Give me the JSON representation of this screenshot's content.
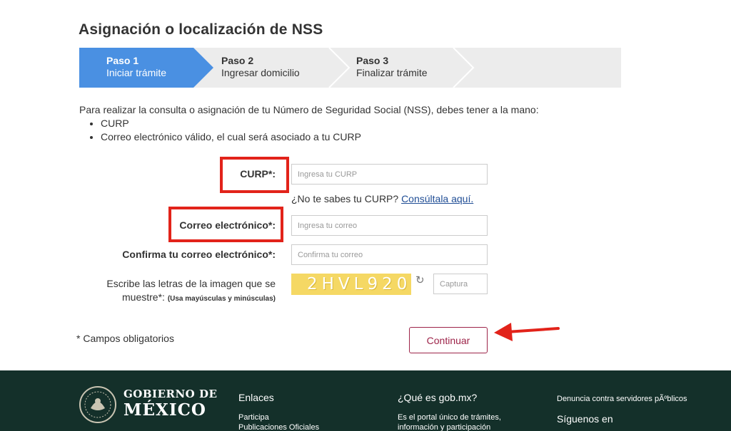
{
  "page": {
    "title": "Asignación o localización de NSS"
  },
  "stepper": {
    "steps": [
      {
        "num": "Paso 1",
        "label": "Iniciar trámite",
        "state": "active"
      },
      {
        "num": "Paso 2",
        "label": "Ingresar domicilio",
        "state": "inactive"
      },
      {
        "num": "Paso 3",
        "label": "Finalizar trámite",
        "state": "inactive"
      }
    ],
    "colors": {
      "active": "#4a90e2",
      "inactive": "#ececec"
    }
  },
  "intro": {
    "text": "Para realizar la consulta o asignación de tu Número de Seguridad Social (NSS), debes tener a la mano:",
    "items": [
      "CURP",
      "Correo electrónico válido, el cual será asociado a tu CURP"
    ]
  },
  "form": {
    "curp_label": "CURP*:",
    "curp_placeholder": "Ingresa tu CURP",
    "curp_hint": "¿No te sabes tu CURP?",
    "curp_link": "Consúltala aquí.",
    "email_label": "Correo electrónico*:",
    "email_placeholder": "Ingresa tu correo",
    "confirm_label": "Confirma tu correo electrónico*:",
    "confirm_placeholder": "Confirma tu correo",
    "captcha_label_1": "Escribe las letras de la imagen que se",
    "captcha_label_2": "muestre*:",
    "captcha_label_small": "(Usa mayúsculas y minúsculas)",
    "captcha_image_text": "2HVL920",
    "captcha_placeholder": "Captura",
    "required_note": "* Campos obligatorios",
    "continue_label": "Continuar"
  },
  "annotations": {
    "highlight_color": "#e2231a"
  },
  "footer": {
    "background": "#14302a",
    "logo_line1": "GOBIERNO DE",
    "logo_line2": "MÉXICO",
    "col1": {
      "heading": "Enlaces",
      "links": [
        "Participa",
        "Publicaciones Oficiales"
      ]
    },
    "col2": {
      "heading": "¿Qué es gob.mx?",
      "text1": "Es el portal único de trámites,",
      "text2": "información y participación"
    },
    "col3": {
      "link": "Denuncia contra servidores pÃºblicos",
      "heading": "Síguenos en"
    }
  }
}
